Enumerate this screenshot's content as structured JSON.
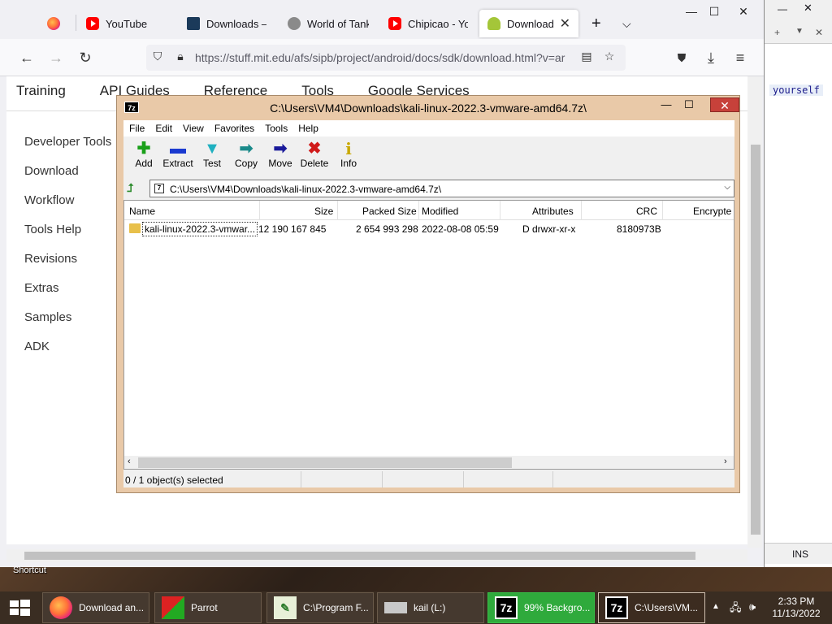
{
  "browser": {
    "tabs": [
      {
        "label": "",
        "icon": "firefox-icon"
      },
      {
        "label": "YouTube",
        "icon": "youtube-icon"
      },
      {
        "label": "Downloads – B",
        "icon": "blender-icon"
      },
      {
        "label": "World of Tanks",
        "icon": "wot-icon"
      },
      {
        "label": "Chipicao - You",
        "icon": "youtube-icon"
      },
      {
        "label": "Download an",
        "icon": "android-icon",
        "active": true
      }
    ],
    "new_tab": "+",
    "url": "https://stuff.mit.edu/afs/sipb/project/android/docs/sdk/download.html?v=ar"
  },
  "page": {
    "topnav": [
      "Training",
      "API Guides",
      "Reference",
      "Tools",
      "Google Services"
    ],
    "sidenav": [
      "Developer Tools",
      "Download",
      "Workflow",
      "Tools Help",
      "Revisions",
      "Extras",
      "Samples",
      "ADK"
    ]
  },
  "sidewin": {
    "word": "yourself",
    "status": "INS"
  },
  "zip": {
    "logo": "7z",
    "title": "C:\\Users\\VM4\\Downloads\\kali-linux-2022.3-vmware-amd64.7z\\",
    "menu": [
      "File",
      "Edit",
      "View",
      "Favorites",
      "Tools",
      "Help"
    ],
    "tools": [
      {
        "label": "Add",
        "icon": "add-icon",
        "glyph": "✚",
        "color": "#1aa01a"
      },
      {
        "label": "Extract",
        "icon": "extract-icon",
        "glyph": "▬",
        "color": "#1a3ad0"
      },
      {
        "label": "Test",
        "icon": "test-icon",
        "glyph": "▼",
        "color": "#20b0c0"
      },
      {
        "label": "Copy",
        "icon": "copy-icon",
        "glyph": "➡",
        "color": "#1a8a8a"
      },
      {
        "label": "Move",
        "icon": "move-icon",
        "glyph": "➡",
        "color": "#1a1a9a"
      },
      {
        "label": "Delete",
        "icon": "delete-icon",
        "glyph": "✖",
        "color": "#d01a1a"
      },
      {
        "label": "Info",
        "icon": "info-icon",
        "glyph": "i",
        "color": "#c8a800"
      }
    ],
    "path": "C:\\Users\\VM4\\Downloads\\kali-linux-2022.3-vmware-amd64.7z\\",
    "columns": [
      "Name",
      "Size",
      "Packed Size",
      "Modified",
      "Attributes",
      "CRC",
      "Encrypte"
    ],
    "rows": [
      {
        "name": "kali-linux-2022.3-vmwar...",
        "size": "12 190 167 845",
        "packed": "2 654 993 298",
        "modified": "2022-08-08 05:59",
        "attributes": "D drwxr-xr-x",
        "crc": "8180973B"
      }
    ],
    "status": "0 / 1 object(s) selected"
  },
  "taskbar": {
    "shortcut_label": "Shortcut",
    "items": [
      {
        "label": "Download an...",
        "icon": "firefox-icon"
      },
      {
        "label": "Parrot",
        "icon": "parrot-icon"
      },
      {
        "label": "C:\\Program F...",
        "icon": "notepad-icon"
      },
      {
        "label": "kail (L:)",
        "icon": "drive-icon"
      },
      {
        "label": "99% Backgro...",
        "icon": "7zip-icon"
      },
      {
        "label": "C:\\Users\\VM...",
        "icon": "7zip-icon"
      }
    ],
    "time": "2:33 PM",
    "date": "11/13/2022"
  }
}
